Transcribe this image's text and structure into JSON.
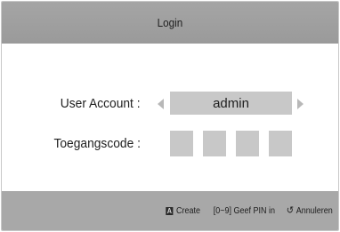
{
  "dialog": {
    "title": "Login"
  },
  "account": {
    "label": "User Account :",
    "value": "admin"
  },
  "passcode": {
    "label": "Toegangscode :",
    "digits": [
      "",
      "",
      "",
      ""
    ]
  },
  "footer": {
    "create_key": "A",
    "create_label": "Create",
    "pin_label": "[0~9] Geef PIN in",
    "return_icon": "↺",
    "cancel_label": "Annuleren"
  }
}
